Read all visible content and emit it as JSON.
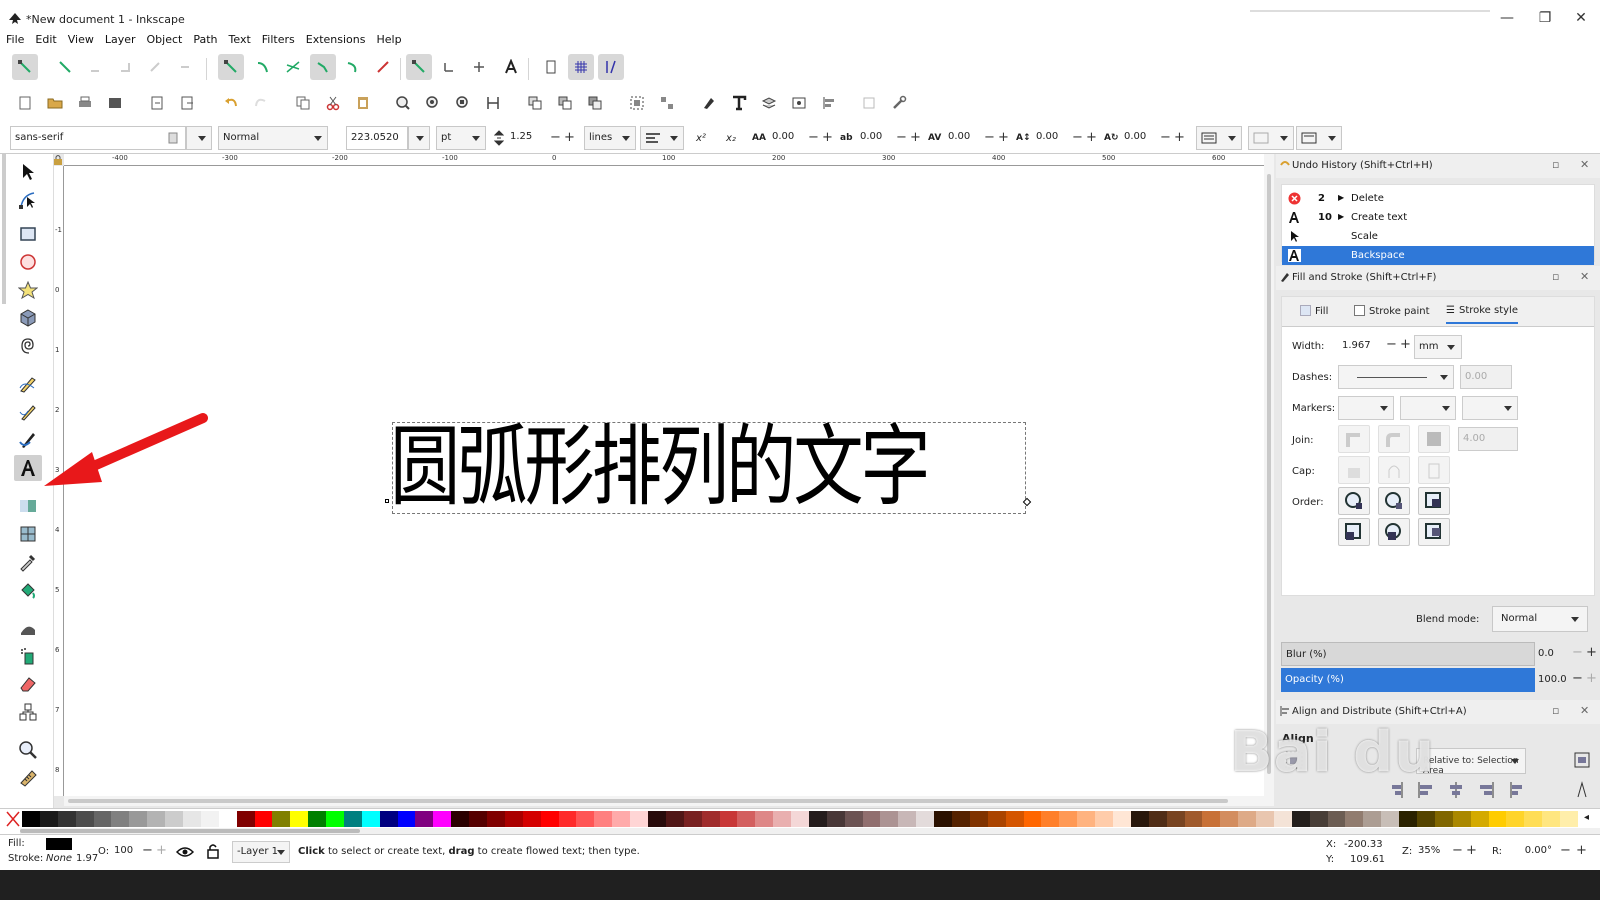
{
  "window": {
    "title": "*New document 1 - Inkscape",
    "minimize": "—",
    "restore": "❐",
    "close": "✕"
  },
  "menu": [
    "File",
    "Edit",
    "View",
    "Layer",
    "Object",
    "Path",
    "Text",
    "Filters",
    "Extensions",
    "Help"
  ],
  "text_toolbar": {
    "font_family": "sans-serif",
    "font_style": "Normal",
    "font_size": "223.0520",
    "unit": "pt",
    "line_spacing": "1.25",
    "line_spacing_mode": "lines",
    "letter_spacing": "0.00",
    "word_spacing": "0.00",
    "kerning": "0.00",
    "vertical_shift": "0.00",
    "rotation": "0.00"
  },
  "ruler": {
    "h_labels": [
      "-400",
      "-300",
      "-200",
      "-100",
      "0",
      "100",
      "200",
      "300",
      "400",
      "500",
      "600"
    ],
    "v_labels": [
      "-1",
      "0",
      "1",
      "2",
      "3",
      "4",
      "5",
      "6",
      "7",
      "8"
    ]
  },
  "canvas": {
    "text": "圆弧形排列的文字"
  },
  "undo_history": {
    "title": "Undo History (Shift+Ctrl+H)",
    "rows": [
      {
        "count": "2",
        "label": "Delete",
        "icon": "delete-icon"
      },
      {
        "count": "10",
        "label": "Create text",
        "icon": "text-icon"
      },
      {
        "count": "",
        "label": "Scale",
        "icon": "pointer-icon"
      },
      {
        "count": "",
        "label": "Backspace",
        "icon": "text-icon",
        "selected": true
      }
    ]
  },
  "fill_stroke": {
    "title": "Fill and Stroke (Shift+Ctrl+F)",
    "tabs": [
      "Fill",
      "Stroke paint",
      "Stroke style"
    ],
    "active_tab": "Stroke style",
    "width_label": "Width:",
    "width_value": "1.967",
    "width_unit": "mm",
    "dashes_label": "Dashes:",
    "dash_offset": "0.00",
    "markers_label": "Markers:",
    "join_label": "Join:",
    "miter_limit": "4.00",
    "cap_label": "Cap:",
    "order_label": "Order:",
    "blend_label": "Blend mode:",
    "blend_value": "Normal",
    "blur_label": "Blur (%)",
    "blur_value": "0.0",
    "opacity_label": "Opacity (%)",
    "opacity_value": "100.0"
  },
  "align": {
    "title": "Align and Distribute (Shift+Ctrl+A)",
    "section": "Align",
    "relative_to": "Relative to: Selection Area"
  },
  "status": {
    "fill_label": "Fill:",
    "stroke_label": "Stroke:",
    "stroke_value": "None",
    "stroke_width": "1.97",
    "opacity_label": "O:",
    "opacity_value": "100",
    "layer": "-Layer 1",
    "message_bold1": "Click",
    "message1": " to select or create text, ",
    "message_bold2": "drag",
    "message2": " to create flowed text; then type.",
    "x_label": "X:",
    "x_value": "-200.33",
    "y_label": "Y:",
    "y_value": "109.61",
    "zoom_label": "Z:",
    "zoom_value": "35%",
    "rotate_label": "R:",
    "rotate_value": "0.00°"
  },
  "watermark": {
    "big": "Bai du",
    "small": "jingyan.baidu.com"
  },
  "palette_colors": [
    "#000000",
    "#1a1a1a",
    "#333333",
    "#4d4d4d",
    "#666666",
    "#808080",
    "#999999",
    "#b3b3b3",
    "#cccccc",
    "#e6e6e6",
    "#f2f2f2",
    "#ffffff",
    "#800000",
    "#ff0000",
    "#808000",
    "#ffff00",
    "#008000",
    "#00ff00",
    "#008080",
    "#00ffff",
    "#000080",
    "#0000ff",
    "#800080",
    "#ff00ff",
    "#2b0000",
    "#550000",
    "#800000",
    "#aa0000",
    "#d40000",
    "#ff0000",
    "#ff2a2a",
    "#ff5555",
    "#ff8080",
    "#ffaaaa",
    "#ffd5d5",
    "#280b0b",
    "#501616",
    "#782121",
    "#a02c2c",
    "#c83737",
    "#d35f5f",
    "#de8787",
    "#e9afaf",
    "#f4d7d7",
    "#241c1c",
    "#483737",
    "#6c5353",
    "#916f6f",
    "#ac9393",
    "#c8b7b7",
    "#e3dbdb",
    "#2b1100",
    "#552200",
    "#803300",
    "#aa4400",
    "#d45500",
    "#ff6600",
    "#ff7f2a",
    "#ff9955",
    "#ffb380",
    "#ffccaa",
    "#ffe6d5",
    "#28170b",
    "#502d16",
    "#784421",
    "#a05a2c",
    "#c87137",
    "#d38d5f",
    "#deaa87",
    "#e9c6af",
    "#f4e3d7",
    "#241f1c",
    "#483e37",
    "#6c5d53",
    "#917c6f",
    "#ac9d93",
    "#c8beb7",
    "#2b2200",
    "#554400",
    "#806600",
    "#aa8800",
    "#d4aa00",
    "#ffcc00",
    "#ffd42a",
    "#ffdd55",
    "#ffe680",
    "#ffeeaa"
  ]
}
